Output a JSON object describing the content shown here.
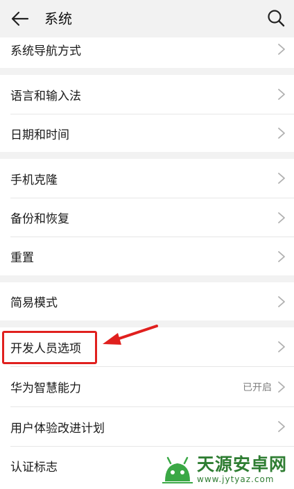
{
  "header": {
    "title": "系统",
    "back_icon": "arrow-left-icon",
    "search_icon": "search-icon"
  },
  "groups": [
    {
      "items": [
        {
          "label": "系统导航方式"
        }
      ]
    },
    {
      "items": [
        {
          "label": "语言和输入法"
        },
        {
          "label": "日期和时间"
        }
      ]
    },
    {
      "items": [
        {
          "label": "手机克隆"
        },
        {
          "label": "备份和恢复"
        },
        {
          "label": "重置"
        }
      ]
    },
    {
      "items": [
        {
          "label": "简易模式"
        }
      ]
    },
    {
      "items": [
        {
          "label": "开发人员选项",
          "highlighted": true
        },
        {
          "label": "华为智慧能力",
          "status": "已开启"
        },
        {
          "label": "用户体验改进计划"
        },
        {
          "label": "认证标志"
        }
      ]
    }
  ],
  "annotation": {
    "color": "#e0201e"
  },
  "watermark": {
    "title": "天源安卓网",
    "url": "www.jytyaz.com"
  }
}
